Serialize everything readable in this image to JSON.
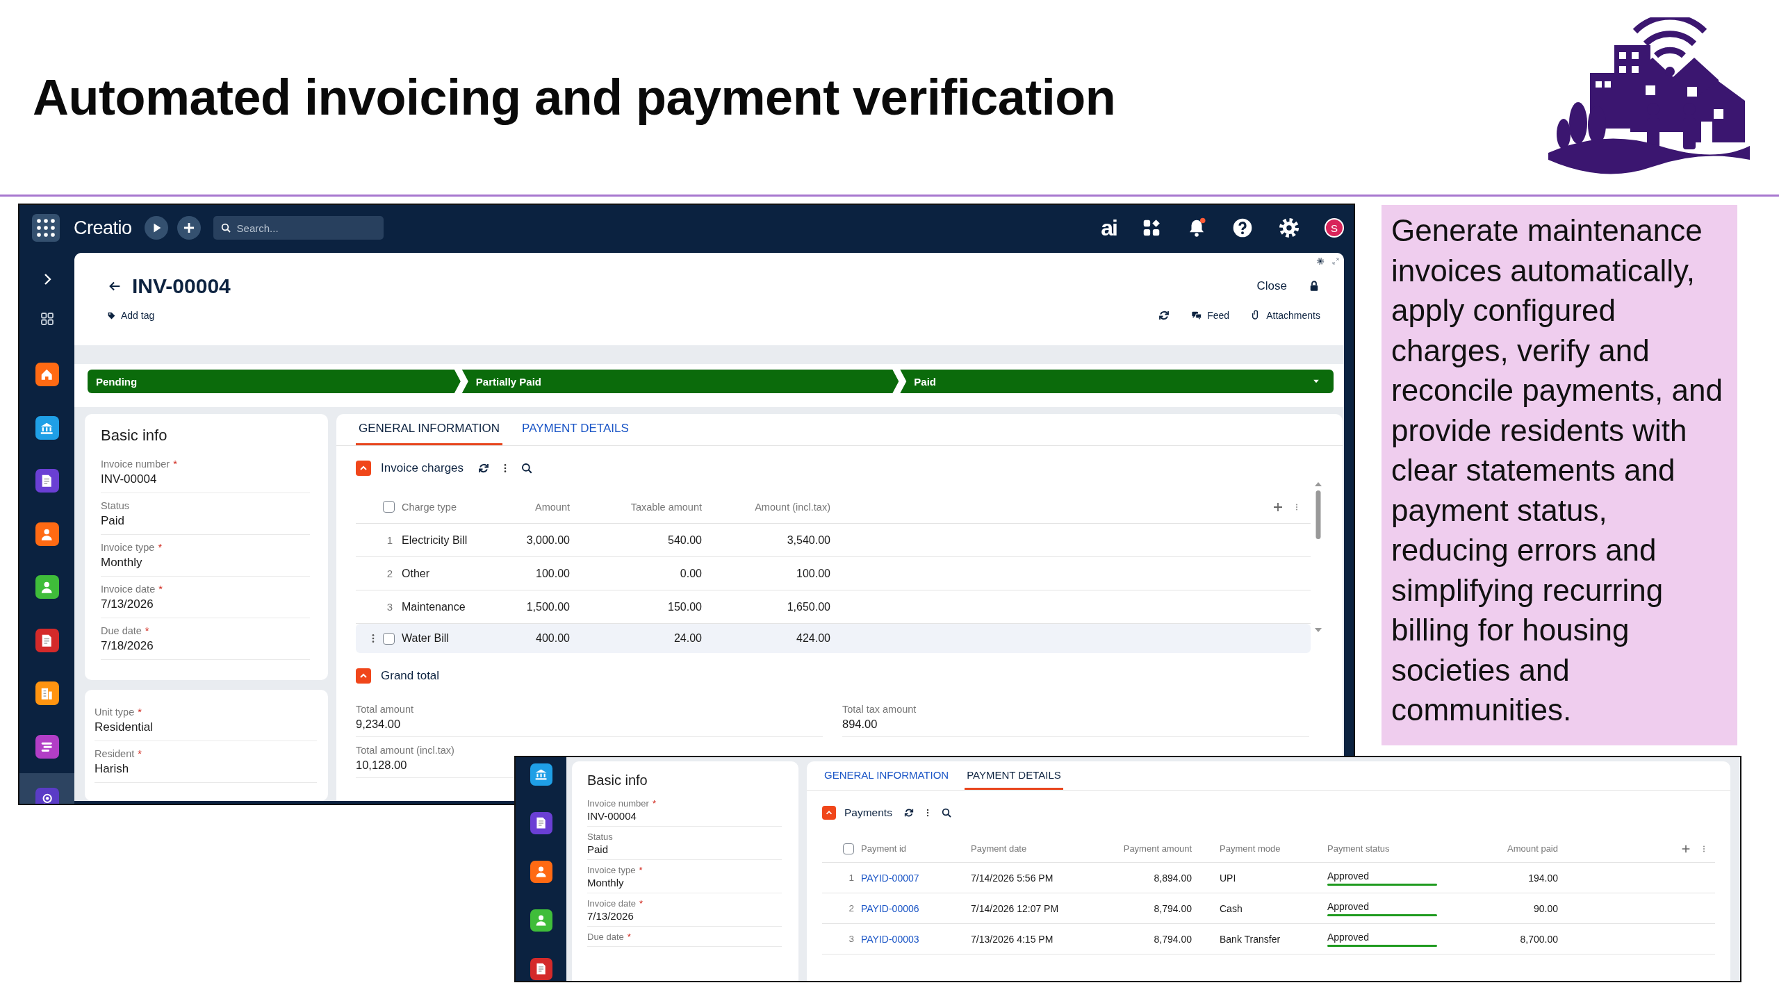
{
  "slide": {
    "title": "Automated invoicing and payment verification",
    "note": "Generate maintenance invoices automatically, apply configured charges, verify and reconcile payments, and provide residents with clear statements and payment status, reducing errors and simplifying recurring billing for housing societies and communities."
  },
  "main_window": {
    "brand": "Creatio",
    "search_placeholder": "Search...",
    "ai_label": "ai",
    "user_initial": "S",
    "sidebar": [
      {
        "color": "#ff6a13",
        "selected": false
      },
      {
        "color": "#1f9fe6",
        "selected": false
      },
      {
        "color": "#6a3fd4",
        "selected": false
      },
      {
        "color": "#ff6a13",
        "selected": false
      },
      {
        "color": "#3fbd3a",
        "selected": false
      },
      {
        "color": "#d42a2a",
        "selected": false
      },
      {
        "color": "#ff9410",
        "selected": false
      },
      {
        "color": "#b23ec6",
        "selected": false
      },
      {
        "color": "#5a3cc6",
        "selected": true
      }
    ],
    "record": {
      "title": "INV-00004",
      "add_tag": "Add tag",
      "close": "Close",
      "feed": "Feed",
      "attachments": "Attachments"
    },
    "stages": [
      {
        "label": "Pending",
        "completed": true
      },
      {
        "label": "Partially Paid",
        "completed": true
      },
      {
        "label": "Paid",
        "completed": true
      }
    ],
    "basic_info": {
      "title": "Basic info",
      "fields": [
        {
          "label": "Invoice number",
          "required_mark": "*",
          "value": "INV-00004"
        },
        {
          "label": "Status",
          "value": "Paid"
        },
        {
          "label": "Invoice type",
          "required_mark": "*",
          "value": "Monthly"
        },
        {
          "label": "Invoice date",
          "required_mark": "*",
          "value": "7/13/2026"
        },
        {
          "label": "Due date",
          "required_mark": "*",
          "value": "7/18/2026"
        }
      ]
    },
    "unit_fields": [
      {
        "label": "Unit type",
        "required_mark": "*",
        "value": "Residential"
      },
      {
        "label": "Resident",
        "required_mark": "*",
        "value": "Harish"
      }
    ],
    "tabs": [
      {
        "label": "GENERAL INFORMATION",
        "selected": true
      },
      {
        "label": "PAYMENT DETAILS",
        "selected": false
      }
    ],
    "charges": {
      "title": "Invoice charges",
      "select_all_checked": false,
      "columns": [
        "Charge type",
        "Amount",
        "Taxable amount",
        "Amount (incl.tax)"
      ],
      "rows": [
        {
          "number": "1",
          "hovered": false,
          "cells": [
            "Electricity Bill",
            "3,000.00",
            "540.00",
            "3,540.00"
          ]
        },
        {
          "number": "2",
          "hovered": false,
          "cells": [
            "Other",
            "100.00",
            "0.00",
            "100.00"
          ]
        },
        {
          "number": "3",
          "hovered": false,
          "cells": [
            "Maintenance",
            "1,500.00",
            "150.00",
            "1,650.00"
          ]
        },
        {
          "hovered": true,
          "checked": false,
          "cells": [
            "Water Bill",
            "400.00",
            "24.00",
            "424.00"
          ]
        }
      ]
    },
    "grand_total": {
      "title": "Grand total",
      "fields": [
        {
          "label": "Total amount",
          "value": "9,234.00"
        },
        {
          "label": "Total tax amount",
          "value": "894.00"
        },
        {
          "label": "Total amount (incl.tax)",
          "value": "10,128.00"
        }
      ]
    }
  },
  "payments_window": {
    "sidebar": [
      {
        "color": "#1f9fe6"
      },
      {
        "color": "#6a3fd4"
      },
      {
        "color": "#ff6a13"
      },
      {
        "color": "#3fbd3a"
      },
      {
        "color": "#d42a2a"
      }
    ],
    "basic_info": {
      "title": "Basic info",
      "fields": [
        {
          "label": "Invoice number",
          "required_mark": "*",
          "value": "INV-00004"
        },
        {
          "label": "Status",
          "value": "Paid"
        },
        {
          "label": "Invoice type",
          "required_mark": "*",
          "value": "Monthly"
        },
        {
          "label": "Invoice date",
          "required_mark": "*",
          "value": "7/13/2026"
        },
        {
          "label": "Due date",
          "required_mark": "*"
        }
      ]
    },
    "tabs": [
      {
        "label": "GENERAL INFORMATION",
        "selected": false
      },
      {
        "label": "PAYMENT DETAILS",
        "selected": true
      }
    ],
    "payments": {
      "title": "Payments",
      "select_all_checked": false,
      "columns": [
        "Payment id",
        "Payment date",
        "Payment amount",
        "Payment mode",
        "Payment status",
        "Amount paid"
      ],
      "rows": [
        {
          "number": "1",
          "id": "PAYID-00007",
          "date": "7/14/2026 5:56 PM",
          "amount": "8,894.00",
          "mode": "UPI",
          "status": "Approved",
          "color": "#1f9a1f",
          "paid": "194.00"
        },
        {
          "number": "2",
          "id": "PAYID-00006",
          "date": "7/14/2026 12:07 PM",
          "amount": "8,794.00",
          "mode": "Cash",
          "status": "Approved",
          "color": "#1f9a1f",
          "paid": "90.00"
        },
        {
          "number": "3",
          "id": "PAYID-00003",
          "date": "7/13/2026 4:15 PM",
          "amount": "8,794.00",
          "mode": "Bank Transfer",
          "status": "Approved",
          "color": "#1f9a1f",
          "paid": "8,700.00"
        }
      ]
    }
  }
}
